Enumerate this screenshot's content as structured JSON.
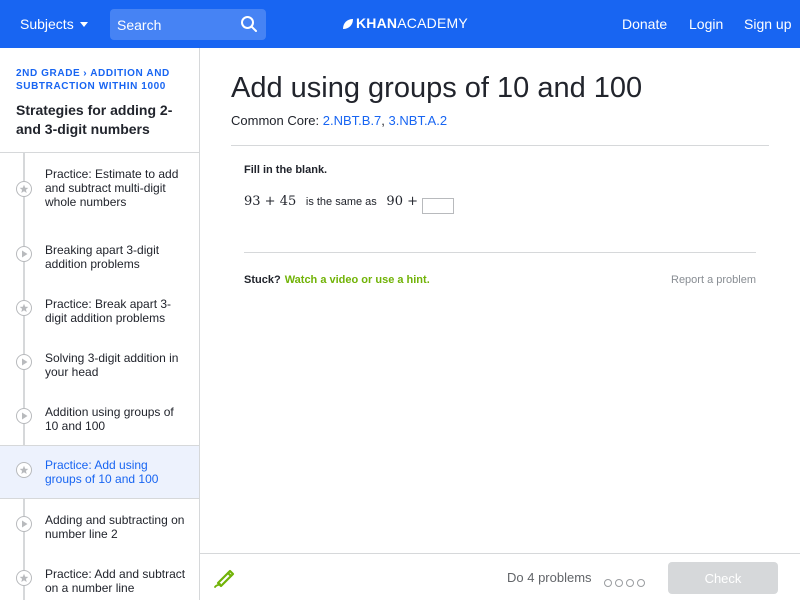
{
  "topbar": {
    "subjects_label": "Subjects",
    "search_placeholder": "Search",
    "logo_prefix": "KHAN",
    "logo_suffix": "ACADEMY",
    "donate": "Donate",
    "login": "Login",
    "signup": "Sign up"
  },
  "sidebar": {
    "breadcrumb": {
      "grade": "2nd grade",
      "unit": "Addition and subtraction within 1000"
    },
    "title": "Strategies for adding 2- and 3-digit numbers",
    "items": [
      {
        "label": "Practice: Estimate to add and subtract multi-digit whole numbers",
        "icon": "star-icon"
      },
      {
        "label": "Breaking apart 3-digit addition problems",
        "icon": "play-icon"
      },
      {
        "label": "Practice: Break apart 3-digit addition problems",
        "icon": "star-icon"
      },
      {
        "label": "Solving 3-digit addition in your head",
        "icon": "play-icon"
      },
      {
        "label": "Addition using groups of 10 and 100",
        "icon": "play-icon"
      },
      {
        "label": "Practice: Add using groups of 10 and 100",
        "icon": "star-icon",
        "active": true
      },
      {
        "label": "Adding and subtracting on number line 2",
        "icon": "play-icon"
      },
      {
        "label": "Practice: Add and subtract on a number line",
        "icon": "star-icon"
      }
    ]
  },
  "main": {
    "title": "Add using groups of 10 and 100",
    "common_core_label": "Common Core:",
    "standards": [
      "2.NBT.B.7",
      "3.NBT.A.2"
    ],
    "standards_sep": ",",
    "prompt": "Fill in the blank.",
    "equation": {
      "left": "93 + 45",
      "middle": "is the same as",
      "right": "90 +"
    },
    "stuck_label": "Stuck?",
    "hint_link": "Watch a video or use a hint.",
    "report": "Report a problem"
  },
  "bottombar": {
    "do_problems": "Do 4 problems",
    "check": "Check"
  },
  "colors": {
    "brand_blue": "#1865f2",
    "hint_green": "#71b307",
    "disabled_gray": "#d6d8da"
  }
}
